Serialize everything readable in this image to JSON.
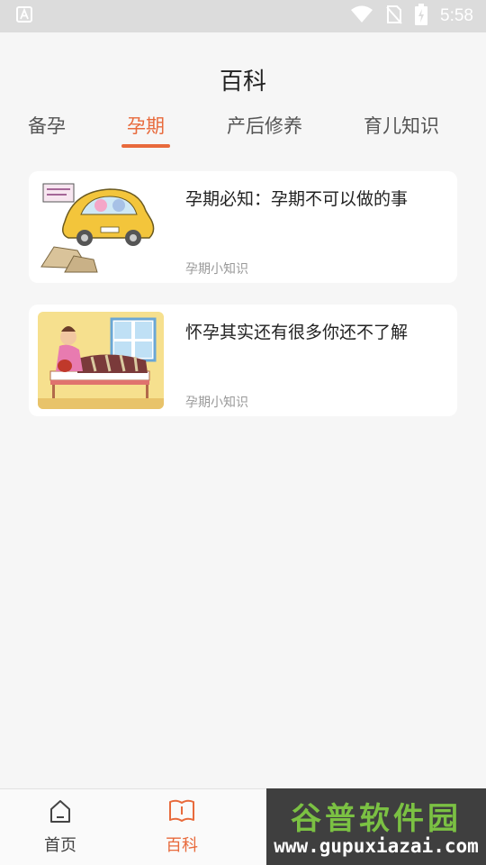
{
  "status_bar": {
    "time": "5:58",
    "icons": [
      "android-notification-icon",
      "wifi-icon",
      "no-sim-icon",
      "battery-charging-icon"
    ]
  },
  "page": {
    "title": "百科"
  },
  "tabs": [
    {
      "label": "备孕",
      "active": false
    },
    {
      "label": "孕期",
      "active": true
    },
    {
      "label": "产后修养",
      "active": false
    },
    {
      "label": "育儿知识",
      "active": false
    }
  ],
  "articles": [
    {
      "title": "孕期必知：孕期不可以做的事",
      "tag": "孕期小知识",
      "image": "car-illustration"
    },
    {
      "title": "怀孕其实还有很多你还不了解",
      "tag": "孕期小知识",
      "image": "pregnant-woman-bed-illustration"
    }
  ],
  "bottom_nav": [
    {
      "label": "首页",
      "icon": "home-icon",
      "active": false
    },
    {
      "label": "百科",
      "icon": "book-icon",
      "active": true
    }
  ],
  "watermark": {
    "title": "谷普软件园",
    "url": "www.gupuxiazai.com"
  },
  "colors": {
    "accent": "#e86a3c",
    "status_bar": "#dcdcdc",
    "background": "#f6f6f6"
  }
}
